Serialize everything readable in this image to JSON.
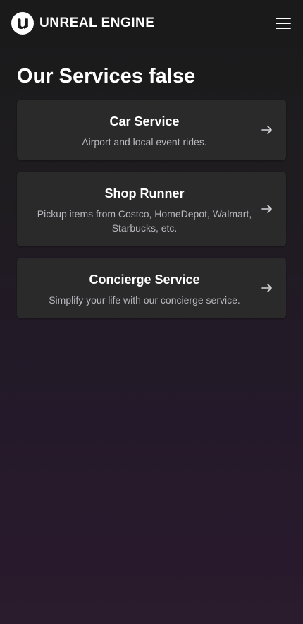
{
  "header": {
    "logo_text": "UNREAL ENGINE",
    "logo_icon": "unreal-engine-logo-icon",
    "menu_icon": "hamburger-menu-icon"
  },
  "main": {
    "title": "Our Services false",
    "services": [
      {
        "title": "Car Service",
        "description": "Airport and local event rides.",
        "icon": "arrow-right-icon"
      },
      {
        "title": "Shop Runner",
        "description": "Pickup items from Costco, HomeDepot, Walmart, Starbucks, etc.",
        "icon": "arrow-right-icon"
      },
      {
        "title": "Concierge Service",
        "description": "Simplify your life with our concierge service.",
        "icon": "arrow-right-icon"
      }
    ]
  },
  "colors": {
    "background_top": "#1a1a1a",
    "background_bottom": "#2a1b2d",
    "card_background": "#2a2a2b",
    "title_text": "#ffffff",
    "secondary_text": "#b8b8be"
  }
}
